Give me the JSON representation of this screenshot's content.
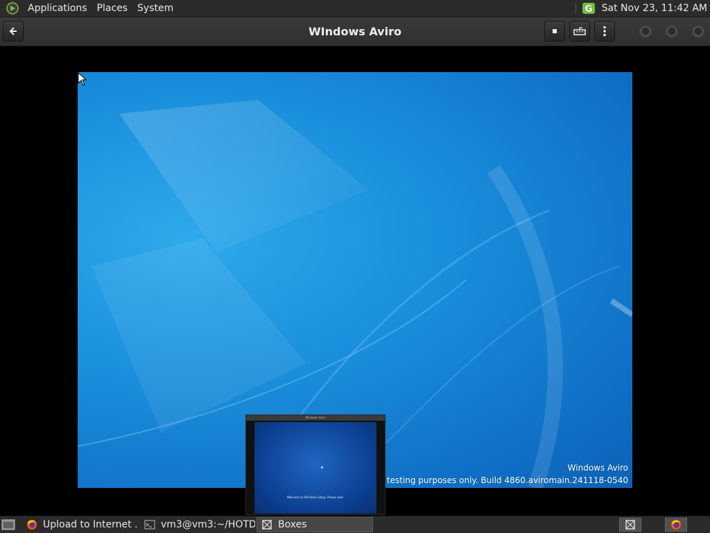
{
  "top_panel": {
    "menus": [
      "Applications",
      "Places",
      "System"
    ],
    "clock": "Sat Nov 23, 11:42 AM"
  },
  "header": {
    "title": "WIndows Aviro"
  },
  "vm": {
    "watermark_line1": "Windows Aviro",
    "watermark_line2": "For testing purposes only. Build 4860.aviromain.241118-0540",
    "wallpaper_colors": [
      "#2fa9ec",
      "#1a8fdc",
      "#0f6fc6",
      "#0b62b6"
    ]
  },
  "preview": {
    "title": "WIndows Aviro",
    "caption": "Welcome to Windows Setup. Please wait."
  },
  "taskbar": {
    "tasks": [
      {
        "label": "Upload to Internet ...",
        "icon": "firefox-icon"
      },
      {
        "label": "vm3@vm3:~/HOTD...",
        "icon": "terminal-icon"
      },
      {
        "label": "Boxes",
        "icon": "boxes-icon",
        "active": true
      }
    ]
  },
  "colors": {
    "panel_bg": "#2b2b2b",
    "header_bg": "#353535",
    "accent_green": "#7ec23c"
  }
}
